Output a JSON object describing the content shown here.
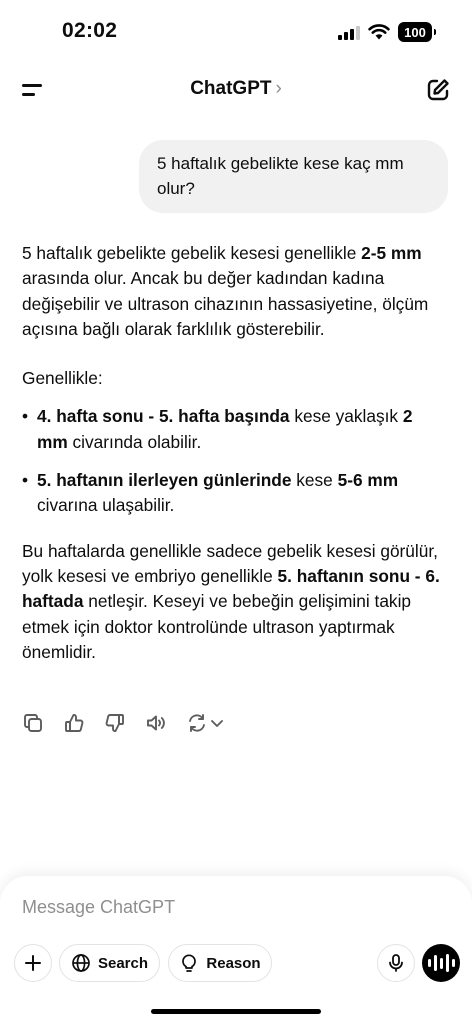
{
  "status_bar": {
    "time": "02:02",
    "battery": "100"
  },
  "header": {
    "title": "ChatGPT",
    "chevron": "›"
  },
  "user_message": "5 haftalık gebelikte kese kaç mm olur?",
  "assistant": {
    "intro": {
      "t1": "5 haftalık gebelikte gebelik kesesi genellikle ",
      "b1": "2-5 mm",
      "t2": " arasında olur. Ancak bu değer kadından kadına değişebilir ve ultrason cihazının hassasiyetine, ölçüm açısına bağlı olarak farklılık gösterebilir."
    },
    "generally": "Genellikle:",
    "bullet1": {
      "b1": "4. hafta sonu - 5. hafta başında",
      "t1": " kese yaklaşık ",
      "b2": "2 mm",
      "t2": " civarında olabilir."
    },
    "bullet2": {
      "b1": "5. haftanın ilerleyen günlerinde",
      "t1": " kese ",
      "b2": "5-6 mm",
      "t2": " civarına ulaşabilir."
    },
    "outro": {
      "t1": "Bu haftalarda genellikle sadece gebelik kesesi görülür, yolk kesesi ve embriyo genellikle ",
      "b1": "5. haftanın sonu - 6. haftada",
      "t2": " netleşir. Keseyi ve bebeğin gelişimini takip etmek için doktor kontrolünde ultrason yaptırmak önemlidir."
    }
  },
  "action_icons": [
    "copy-icon",
    "thumbs-up-icon",
    "thumbs-down-icon",
    "read-aloud-icon",
    "regenerate-icon",
    "chevron-down-icon"
  ],
  "composer": {
    "placeholder": "Message ChatGPT",
    "search_label": "Search",
    "reason_label": "Reason"
  }
}
